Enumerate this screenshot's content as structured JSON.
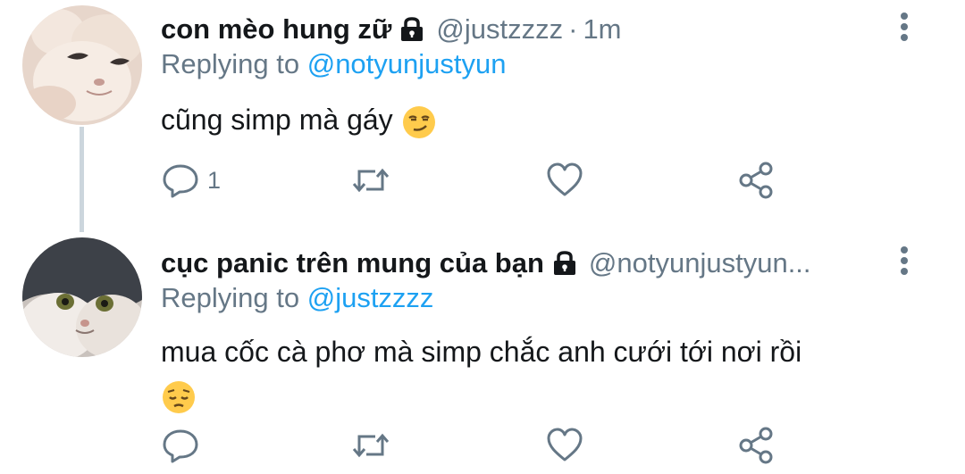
{
  "tweets": [
    {
      "display_name": "con mèo hung zữ",
      "handle": "@justzzzz",
      "separator": "·",
      "time": "1m",
      "reply_label": "Replying to",
      "reply_to": "@notyunjustyun",
      "text": "cũng simp mà gáy",
      "emoji": "smirking-face",
      "reply_count": "1",
      "avatar": "white-cat-face"
    },
    {
      "display_name": "cục panic trên mung của bạn",
      "handle": "@notyunjustyun...",
      "reply_label": "Replying to",
      "reply_to": "@justzzzz",
      "text": "mua cốc cà phơ mà simp chắc anh cưới tới nơi rồi",
      "emoji": "pensive-face",
      "avatar": "gray-white-cat-face"
    }
  ],
  "colors": {
    "text": "#14171a",
    "secondary": "#657786",
    "link": "#1da1f2",
    "thread_line": "#ccd6dd",
    "icon": "#657786"
  }
}
